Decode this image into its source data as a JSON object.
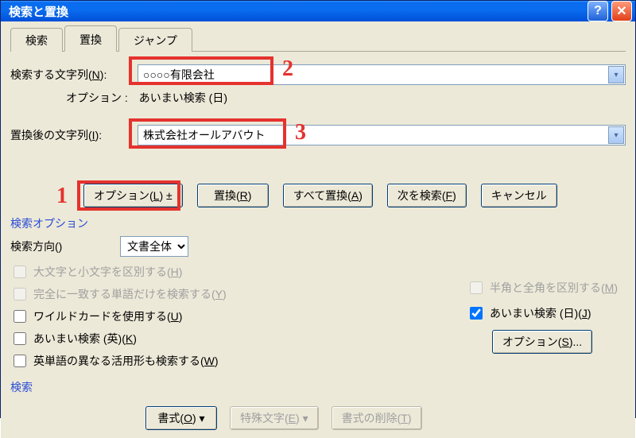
{
  "window": {
    "title": "検索と置換"
  },
  "tabs": {
    "search": "検索",
    "replace": "置換",
    "jump": "ジャンプ"
  },
  "fields": {
    "find_label_pre": "検索する文字列(",
    "find_label_key": "N",
    "find_label_post": "):",
    "find_value": "○○○○有限会社",
    "options_line": "オプション :　あいまい検索 (日)",
    "replace_label_pre": "置換後の文字列(",
    "replace_label_key": "I",
    "replace_label_post": "):",
    "replace_value": "株式会社オールアバウト"
  },
  "buttons": {
    "options_pre": "オプション(",
    "options_key": "L",
    "options_post": ")  ±",
    "replace_pre": "置換(",
    "replace_key": "R",
    "replace_post": ")",
    "replace_all_pre": "すべて置換(",
    "replace_all_key": "A",
    "replace_all_post": ")",
    "find_next_pre": "次を検索(",
    "find_next_key": "F",
    "find_next_post": ")",
    "cancel": "キャンセル",
    "format_pre": "書式(",
    "format_key": "O",
    "format_post": ") ▾",
    "special_pre": "特殊文字(",
    "special_key": "E",
    "special_post": ") ▾",
    "clear_fmt_pre": "書式の削除(",
    "clear_fmt_key": "T",
    "clear_fmt_post": ")",
    "fuzzy_opt_pre": "オプション(",
    "fuzzy_opt_key": "S",
    "fuzzy_opt_post": ")..."
  },
  "section": {
    "search_options": "検索オプション",
    "search_bottom": "検索"
  },
  "direction": {
    "label_pre": "検索方向(",
    "label_key": "",
    "label_post": ")",
    "value": "文書全体"
  },
  "checks": {
    "case_pre": "大文字と小文字を区別する(",
    "case_key": "H",
    "case_post": ")",
    "whole_pre": "完全に一致する単語だけを検索する(",
    "whole_key": "Y",
    "whole_post": ")",
    "wildcard_pre": "ワイルドカードを使用する(",
    "wildcard_key": "U",
    "wildcard_post": ")",
    "fuzzy_en_pre": "あいまい検索 (英)(",
    "fuzzy_en_key": "K",
    "fuzzy_en_post": ")",
    "wordforms_pre": "英単語の異なる活用形も検索する(",
    "wordforms_key": "W",
    "wordforms_post": ")",
    "halffull_pre": "半角と全角を区別する(",
    "halffull_key": "M",
    "halffull_post": ")",
    "fuzzy_jp_pre": "あいまい検索 (日)(",
    "fuzzy_jp_key": "J",
    "fuzzy_jp_post": ")"
  },
  "annotations": {
    "one": "1",
    "two": "2",
    "three": "3"
  }
}
